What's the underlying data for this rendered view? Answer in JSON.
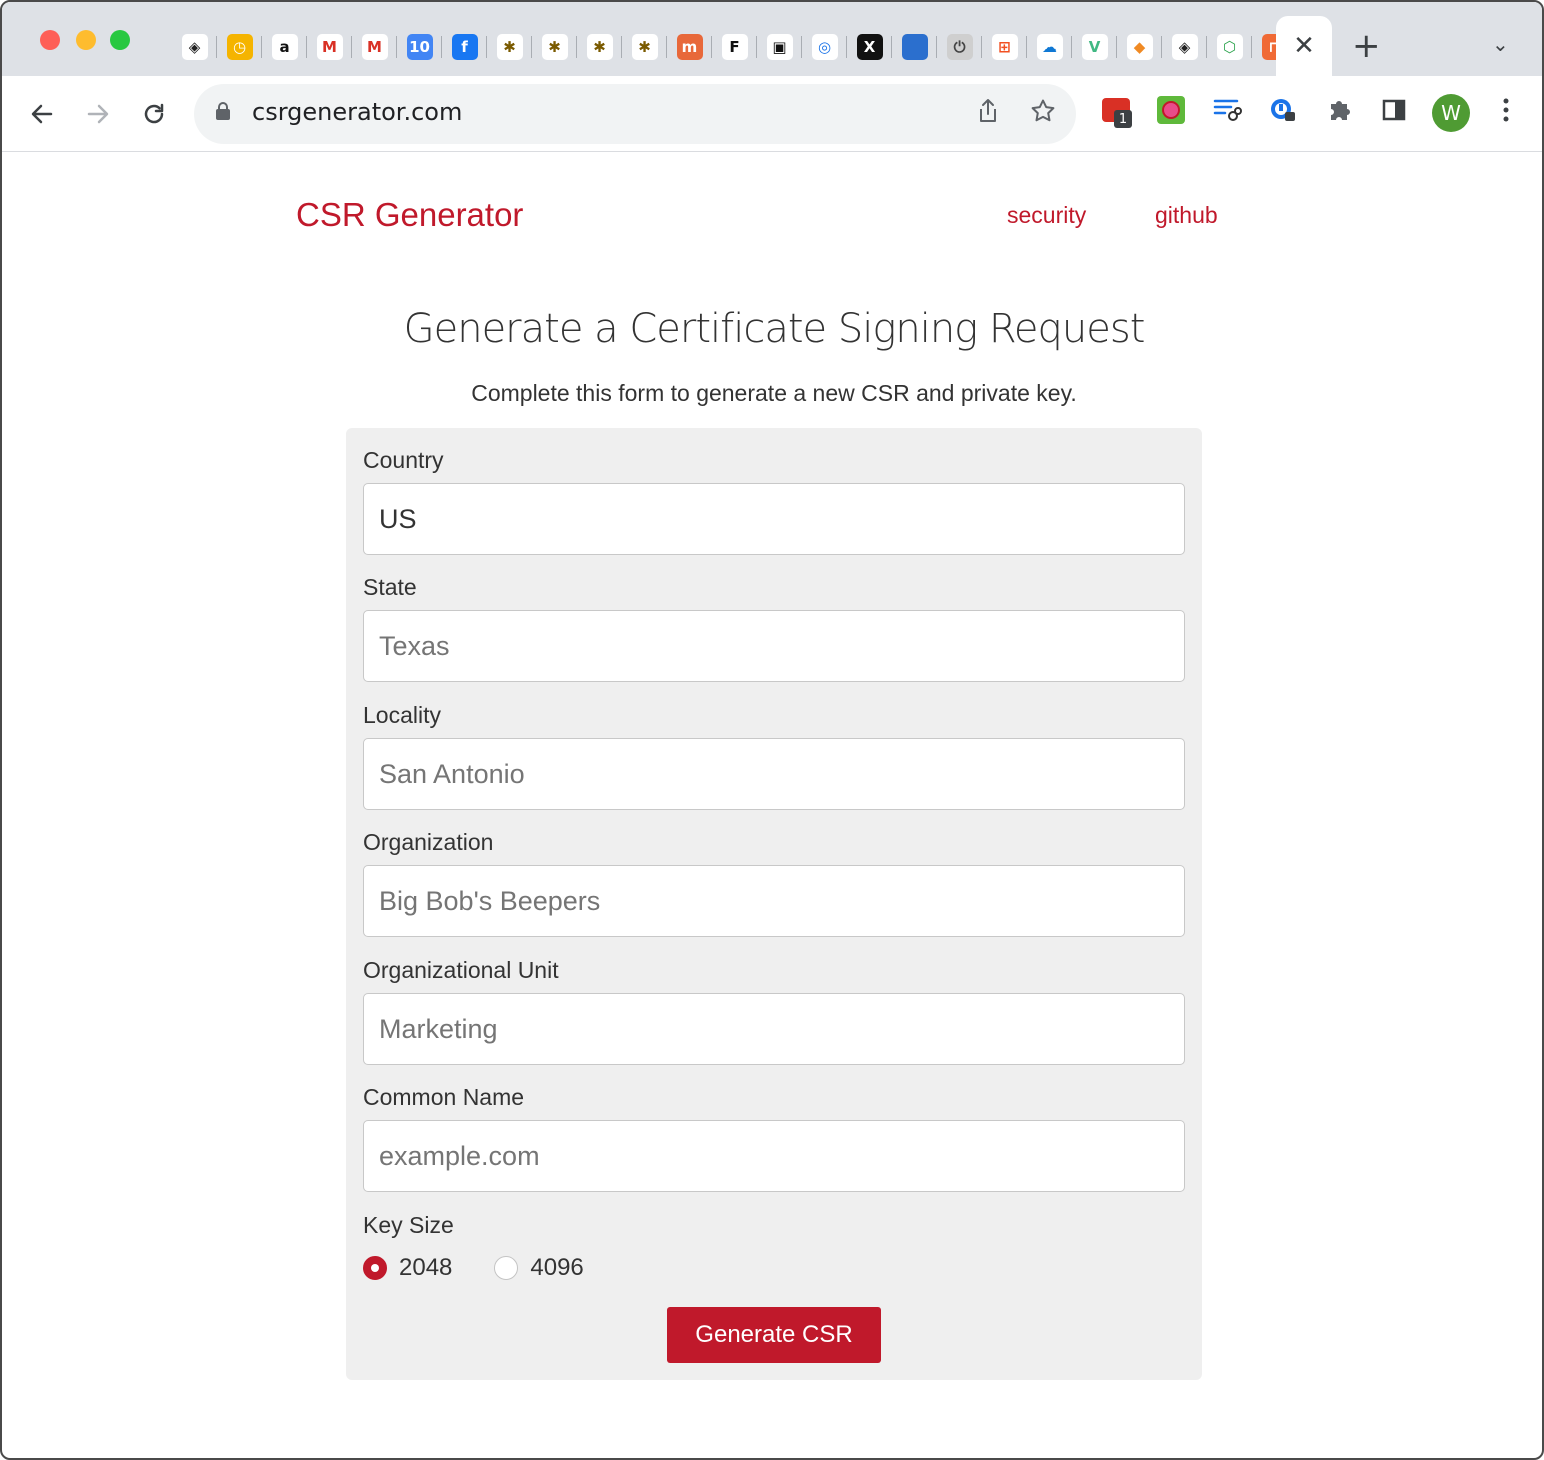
{
  "browser": {
    "active_tab_close": "✕",
    "new_tab": "+",
    "tab_search": "⌄",
    "pinned_tabs": [
      {
        "icon": "github-alt-icon",
        "glyph": "◈",
        "bg": "#ffffff",
        "color": "#222222"
      },
      {
        "icon": "clock-icon",
        "glyph": "◷",
        "bg": "#f5b400",
        "color": "#ffffff"
      },
      {
        "icon": "amazon-icon",
        "glyph": "a",
        "bg": "#ffffff",
        "color": "#111111"
      },
      {
        "icon": "gmail-count-icon",
        "glyph": "M",
        "bg": "#ffffff",
        "color": "#d93025"
      },
      {
        "icon": "gmail-icon",
        "glyph": "M",
        "bg": "#ffffff",
        "color": "#d93025"
      },
      {
        "icon": "calendar-icon",
        "glyph": "10",
        "bg": "#4285f4",
        "color": "#ffffff"
      },
      {
        "icon": "facebook-icon",
        "glyph": "f",
        "bg": "#1877f2",
        "color": "#ffffff"
      },
      {
        "icon": "bee-icon",
        "glyph": "✱",
        "bg": "#ffffff",
        "color": "#7a5a00"
      },
      {
        "icon": "bee-icon",
        "glyph": "✱",
        "bg": "#ffffff",
        "color": "#7a5a00"
      },
      {
        "icon": "bee-icon",
        "glyph": "✱",
        "bg": "#ffffff",
        "color": "#7a5a00"
      },
      {
        "icon": "bee-icon",
        "glyph": "✱",
        "bg": "#ffffff",
        "color": "#7a5a00"
      },
      {
        "icon": "m-app-icon",
        "glyph": "m",
        "bg": "#e8683a",
        "color": "#ffffff"
      },
      {
        "icon": "f-app-icon",
        "glyph": "F",
        "bg": "#ffffff",
        "color": "#111111"
      },
      {
        "icon": "square-app-icon",
        "glyph": "▣",
        "bg": "#ffffff",
        "color": "#111111"
      },
      {
        "icon": "swirl-icon",
        "glyph": "◎",
        "bg": "#ffffff",
        "color": "#1a73e8"
      },
      {
        "icon": "x-icon",
        "glyph": "X",
        "bg": "#111111",
        "color": "#ffffff"
      },
      {
        "icon": "blue-square-icon",
        "glyph": "",
        "bg": "#2b6fce",
        "color": "#ffffff"
      },
      {
        "icon": "power-icon",
        "glyph": "⏻",
        "bg": "#cfcfcf",
        "color": "#444444"
      },
      {
        "icon": "microsoft-icon",
        "glyph": "⊞",
        "bg": "#ffffff",
        "color": "#f25022"
      },
      {
        "icon": "cloud-icon",
        "glyph": "☁",
        "bg": "#ffffff",
        "color": "#0f78d4"
      },
      {
        "icon": "vue-icon",
        "glyph": "V",
        "bg": "#ffffff",
        "color": "#41b883"
      },
      {
        "icon": "cube-icon",
        "glyph": "◆",
        "bg": "#ffffff",
        "color": "#f08a24"
      },
      {
        "icon": "github-alt-icon",
        "glyph": "◈",
        "bg": "#ffffff",
        "color": "#222222"
      },
      {
        "icon": "hexagon-icon",
        "glyph": "⬡",
        "bg": "#ffffff",
        "color": "#2da44e"
      },
      {
        "icon": "shopping-bag-icon",
        "glyph": "⊓",
        "bg": "#f06a35",
        "color": "#ffffff"
      }
    ],
    "url": "csrgenerator.com",
    "extension_badge": "1",
    "profile_initial": "W"
  },
  "site": {
    "brand": "CSR Generator",
    "nav": [
      "security",
      "github"
    ]
  },
  "page": {
    "title": "Generate a Certificate Signing Request",
    "subtitle": "Complete this form to generate a new CSR and private key."
  },
  "form": {
    "fields": [
      {
        "label": "Country",
        "value": "US",
        "placeholder": ""
      },
      {
        "label": "State",
        "value": "",
        "placeholder": "Texas"
      },
      {
        "label": "Locality",
        "value": "",
        "placeholder": "San Antonio"
      },
      {
        "label": "Organization",
        "value": "",
        "placeholder": "Big Bob's Beepers"
      },
      {
        "label": "Organizational Unit",
        "value": "",
        "placeholder": "Marketing"
      },
      {
        "label": "Common Name",
        "value": "",
        "placeholder": "example.com"
      }
    ],
    "key_size_label": "Key Size",
    "key_sizes": [
      {
        "label": "2048",
        "selected": true
      },
      {
        "label": "4096",
        "selected": false
      }
    ],
    "submit_label": "Generate CSR"
  },
  "colors": {
    "accent": "#c0192b"
  }
}
